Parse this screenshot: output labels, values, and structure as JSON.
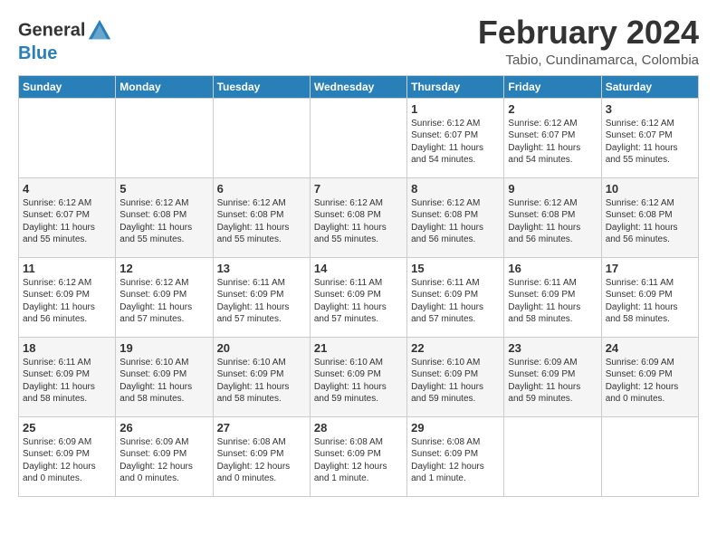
{
  "header": {
    "logo_general": "General",
    "logo_blue": "Blue",
    "month_title": "February 2024",
    "location": "Tabio, Cundinamarca, Colombia"
  },
  "days_of_week": [
    "Sunday",
    "Monday",
    "Tuesday",
    "Wednesday",
    "Thursday",
    "Friday",
    "Saturday"
  ],
  "weeks": [
    [
      {
        "day": "",
        "info": ""
      },
      {
        "day": "",
        "info": ""
      },
      {
        "day": "",
        "info": ""
      },
      {
        "day": "",
        "info": ""
      },
      {
        "day": "1",
        "info": "Sunrise: 6:12 AM\nSunset: 6:07 PM\nDaylight: 11 hours\nand 54 minutes."
      },
      {
        "day": "2",
        "info": "Sunrise: 6:12 AM\nSunset: 6:07 PM\nDaylight: 11 hours\nand 54 minutes."
      },
      {
        "day": "3",
        "info": "Sunrise: 6:12 AM\nSunset: 6:07 PM\nDaylight: 11 hours\nand 55 minutes."
      }
    ],
    [
      {
        "day": "4",
        "info": "Sunrise: 6:12 AM\nSunset: 6:07 PM\nDaylight: 11 hours\nand 55 minutes."
      },
      {
        "day": "5",
        "info": "Sunrise: 6:12 AM\nSunset: 6:08 PM\nDaylight: 11 hours\nand 55 minutes."
      },
      {
        "day": "6",
        "info": "Sunrise: 6:12 AM\nSunset: 6:08 PM\nDaylight: 11 hours\nand 55 minutes."
      },
      {
        "day": "7",
        "info": "Sunrise: 6:12 AM\nSunset: 6:08 PM\nDaylight: 11 hours\nand 55 minutes."
      },
      {
        "day": "8",
        "info": "Sunrise: 6:12 AM\nSunset: 6:08 PM\nDaylight: 11 hours\nand 56 minutes."
      },
      {
        "day": "9",
        "info": "Sunrise: 6:12 AM\nSunset: 6:08 PM\nDaylight: 11 hours\nand 56 minutes."
      },
      {
        "day": "10",
        "info": "Sunrise: 6:12 AM\nSunset: 6:08 PM\nDaylight: 11 hours\nand 56 minutes."
      }
    ],
    [
      {
        "day": "11",
        "info": "Sunrise: 6:12 AM\nSunset: 6:09 PM\nDaylight: 11 hours\nand 56 minutes."
      },
      {
        "day": "12",
        "info": "Sunrise: 6:12 AM\nSunset: 6:09 PM\nDaylight: 11 hours\nand 57 minutes."
      },
      {
        "day": "13",
        "info": "Sunrise: 6:11 AM\nSunset: 6:09 PM\nDaylight: 11 hours\nand 57 minutes."
      },
      {
        "day": "14",
        "info": "Sunrise: 6:11 AM\nSunset: 6:09 PM\nDaylight: 11 hours\nand 57 minutes."
      },
      {
        "day": "15",
        "info": "Sunrise: 6:11 AM\nSunset: 6:09 PM\nDaylight: 11 hours\nand 57 minutes."
      },
      {
        "day": "16",
        "info": "Sunrise: 6:11 AM\nSunset: 6:09 PM\nDaylight: 11 hours\nand 58 minutes."
      },
      {
        "day": "17",
        "info": "Sunrise: 6:11 AM\nSunset: 6:09 PM\nDaylight: 11 hours\nand 58 minutes."
      }
    ],
    [
      {
        "day": "18",
        "info": "Sunrise: 6:11 AM\nSunset: 6:09 PM\nDaylight: 11 hours\nand 58 minutes."
      },
      {
        "day": "19",
        "info": "Sunrise: 6:10 AM\nSunset: 6:09 PM\nDaylight: 11 hours\nand 58 minutes."
      },
      {
        "day": "20",
        "info": "Sunrise: 6:10 AM\nSunset: 6:09 PM\nDaylight: 11 hours\nand 58 minutes."
      },
      {
        "day": "21",
        "info": "Sunrise: 6:10 AM\nSunset: 6:09 PM\nDaylight: 11 hours\nand 59 minutes."
      },
      {
        "day": "22",
        "info": "Sunrise: 6:10 AM\nSunset: 6:09 PM\nDaylight: 11 hours\nand 59 minutes."
      },
      {
        "day": "23",
        "info": "Sunrise: 6:09 AM\nSunset: 6:09 PM\nDaylight: 11 hours\nand 59 minutes."
      },
      {
        "day": "24",
        "info": "Sunrise: 6:09 AM\nSunset: 6:09 PM\nDaylight: 12 hours\nand 0 minutes."
      }
    ],
    [
      {
        "day": "25",
        "info": "Sunrise: 6:09 AM\nSunset: 6:09 PM\nDaylight: 12 hours\nand 0 minutes."
      },
      {
        "day": "26",
        "info": "Sunrise: 6:09 AM\nSunset: 6:09 PM\nDaylight: 12 hours\nand 0 minutes."
      },
      {
        "day": "27",
        "info": "Sunrise: 6:08 AM\nSunset: 6:09 PM\nDaylight: 12 hours\nand 0 minutes."
      },
      {
        "day": "28",
        "info": "Sunrise: 6:08 AM\nSunset: 6:09 PM\nDaylight: 12 hours\nand 1 minute."
      },
      {
        "day": "29",
        "info": "Sunrise: 6:08 AM\nSunset: 6:09 PM\nDaylight: 12 hours\nand 1 minute."
      },
      {
        "day": "",
        "info": ""
      },
      {
        "day": "",
        "info": ""
      }
    ]
  ]
}
